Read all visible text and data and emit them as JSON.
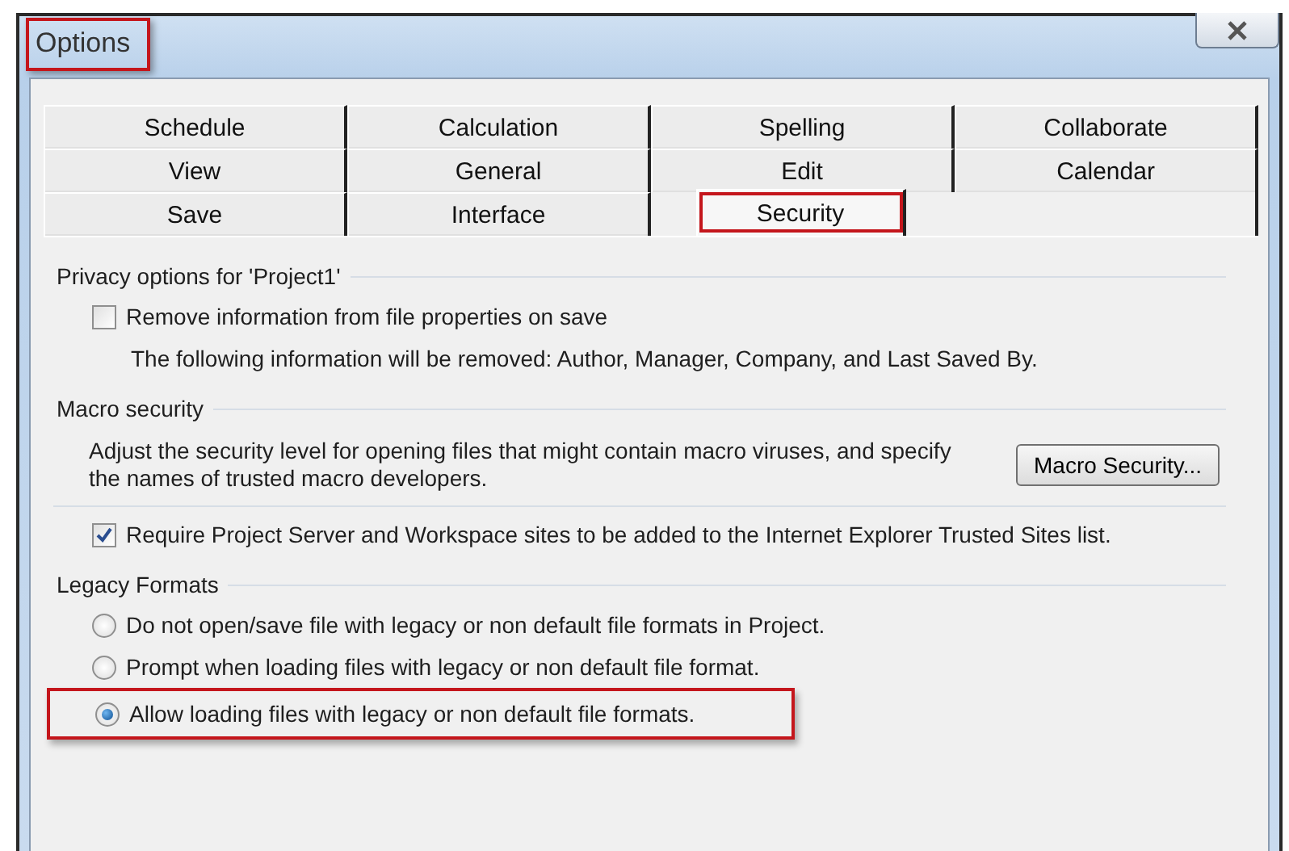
{
  "window": {
    "title": "Options",
    "title_highlighted": true
  },
  "tab_rows": [
    [
      {
        "label": "Schedule",
        "selected": false,
        "highlighted": false
      },
      {
        "label": "Calculation",
        "selected": false,
        "highlighted": false
      },
      {
        "label": "Spelling",
        "selected": false,
        "highlighted": false
      },
      {
        "label": "Collaborate",
        "selected": false,
        "highlighted": false
      }
    ],
    [
      {
        "label": "View",
        "selected": false,
        "highlighted": false
      },
      {
        "label": "General",
        "selected": false,
        "highlighted": false
      },
      {
        "label": "Edit",
        "selected": false,
        "highlighted": false
      },
      {
        "label": "Calendar",
        "selected": false,
        "highlighted": false
      }
    ],
    [
      {
        "label": "Save",
        "selected": false,
        "highlighted": false
      },
      {
        "label": "Interface",
        "selected": false,
        "highlighted": false
      },
      {
        "label": "Security",
        "selected": true,
        "highlighted": true
      }
    ]
  ],
  "privacy": {
    "heading": "Privacy options for 'Project1'",
    "checkbox": {
      "label": "Remove information from file properties on save",
      "checked": false
    },
    "note": "The following information will be removed: Author, Manager, Company, and Last Saved By."
  },
  "macro": {
    "heading": "Macro security",
    "text": "Adjust the security level for opening files that might contain macro viruses, and specify the names of trusted macro developers.",
    "button": "Macro Security..."
  },
  "trusted": {
    "label": "Require Project Server and Workspace sites to be added to the Internet Explorer Trusted Sites list.",
    "checked": true
  },
  "legacy": {
    "heading": "Legacy Formats",
    "options": [
      {
        "label": "Do not open/save file with legacy or non default file formats in Project.",
        "selected": false,
        "highlighted": false
      },
      {
        "label": "Prompt when loading files with legacy or non default file format.",
        "selected": false,
        "highlighted": false
      },
      {
        "label": "Allow loading files with legacy or non default file formats.",
        "selected": true,
        "highlighted": true
      }
    ]
  }
}
